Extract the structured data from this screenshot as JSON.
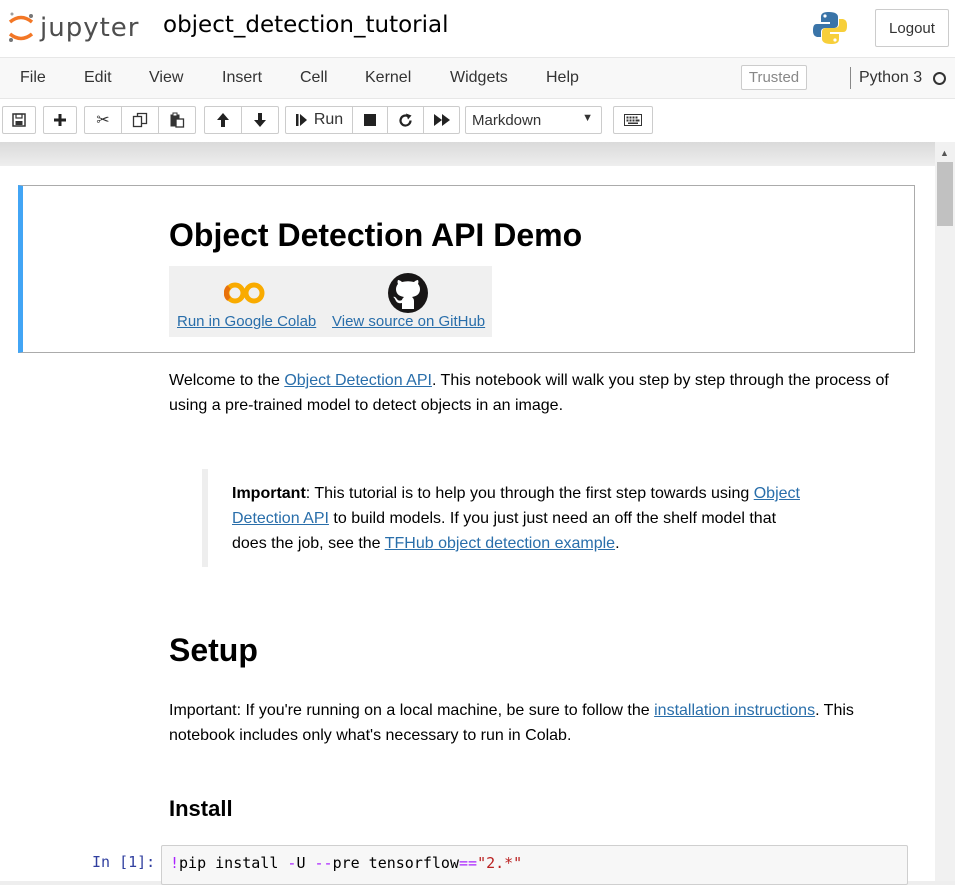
{
  "header": {
    "logo_text": "jupyter",
    "notebook_title": "object_detection_tutorial",
    "logout_label": "Logout"
  },
  "menubar": {
    "items": [
      "File",
      "Edit",
      "View",
      "Insert",
      "Cell",
      "Kernel",
      "Widgets",
      "Help"
    ],
    "trusted_label": "Trusted",
    "kernel_name": "Python 3"
  },
  "toolbar": {
    "buttons": [
      "save-icon",
      "plus-icon",
      "scissors-icon",
      "copy-icon",
      "paste-icon",
      "arrow-up-icon",
      "arrow-down-icon",
      "run-icon",
      "stop-icon",
      "restart-icon",
      "fast-forward-icon",
      "keyboard-icon"
    ],
    "run_label": "Run",
    "cell_type": "Markdown"
  },
  "notebook": {
    "title": "Object Detection API Demo",
    "colab_link": "Run in Google Colab",
    "github_link": "View source on GitHub",
    "intro_before": "Welcome to the ",
    "intro_link": "Object Detection API",
    "intro_after": ". This notebook will walk you step by step through the process of using a pre-trained model to detect objects in an image.",
    "callout_bold": "Important",
    "callout_text1": ": This tutorial is to help you through the first step towards using ",
    "callout_link1": "Object Detection API",
    "callout_text2": " to build models. If you just just need an off the shelf model that does the job, see the ",
    "callout_link2": "TFHub object detection example",
    "callout_text3": ".",
    "setup_heading": "Setup",
    "setup_before": "Important: If you're running on a local machine, be sure to follow the ",
    "setup_link": "installation instructions",
    "setup_after": ". This notebook includes only what's necessary to run in Colab.",
    "install_heading": "Install",
    "prompt": "In [1]:",
    "code_bang": "!",
    "code_cmd": "pip install ",
    "code_op1": "-",
    "code_flag1": "U ",
    "code_op2": "--",
    "code_flag2": "pre tensorflow",
    "code_op3": "==",
    "code_str": "\"2.*\""
  },
  "colors": {
    "accent": "#42a5f5",
    "link": "#296eaa",
    "jupyter_orange": "#f37726"
  }
}
